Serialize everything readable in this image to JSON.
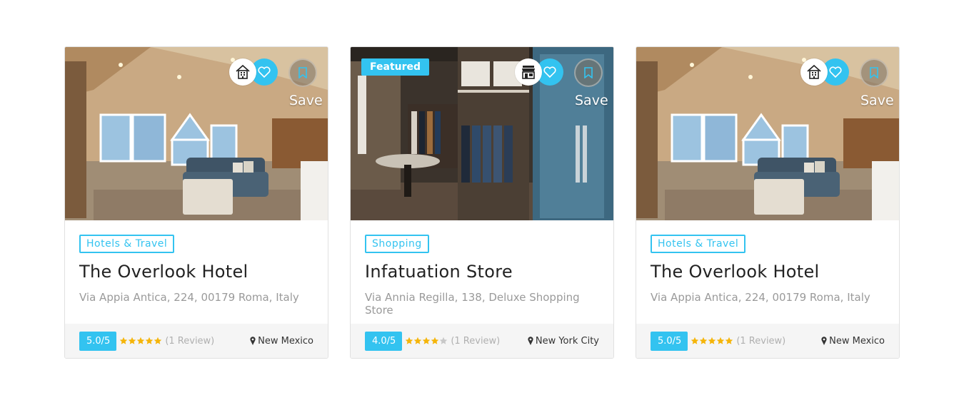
{
  "listings": [
    {
      "category": "Hotels & Travel",
      "category_icon": "hotel-icon",
      "title": "The Overlook Hotel",
      "address": "Via Appia Antica, 224, 00179 Roma, Italy",
      "rating": "5.0/5",
      "stars": 5,
      "reviews": "(1 Review)",
      "location": "New Mexico",
      "save_label": "Save",
      "featured": null
    },
    {
      "category": "Shopping",
      "category_icon": "store-icon",
      "title": "Infatuation Store",
      "address": "Via Annia Regilla, 138, Deluxe Shopping Store",
      "rating": "4.0/5",
      "stars": 4,
      "reviews": "(1 Review)",
      "location": "New York City",
      "save_label": "Save",
      "featured": "Featured"
    },
    {
      "category": "Hotels & Travel",
      "category_icon": "hotel-icon",
      "title": "The Overlook Hotel",
      "address": "Via Appia Antica, 224, 00179 Roma, Italy",
      "rating": "5.0/5",
      "stars": 5,
      "reviews": "(1 Review)",
      "location": "New Mexico",
      "save_label": "Save",
      "featured": null
    }
  ],
  "colors": {
    "accent": "#33c3f0",
    "star_filled": "#f5b50a",
    "star_empty": "#c8c8c8"
  }
}
